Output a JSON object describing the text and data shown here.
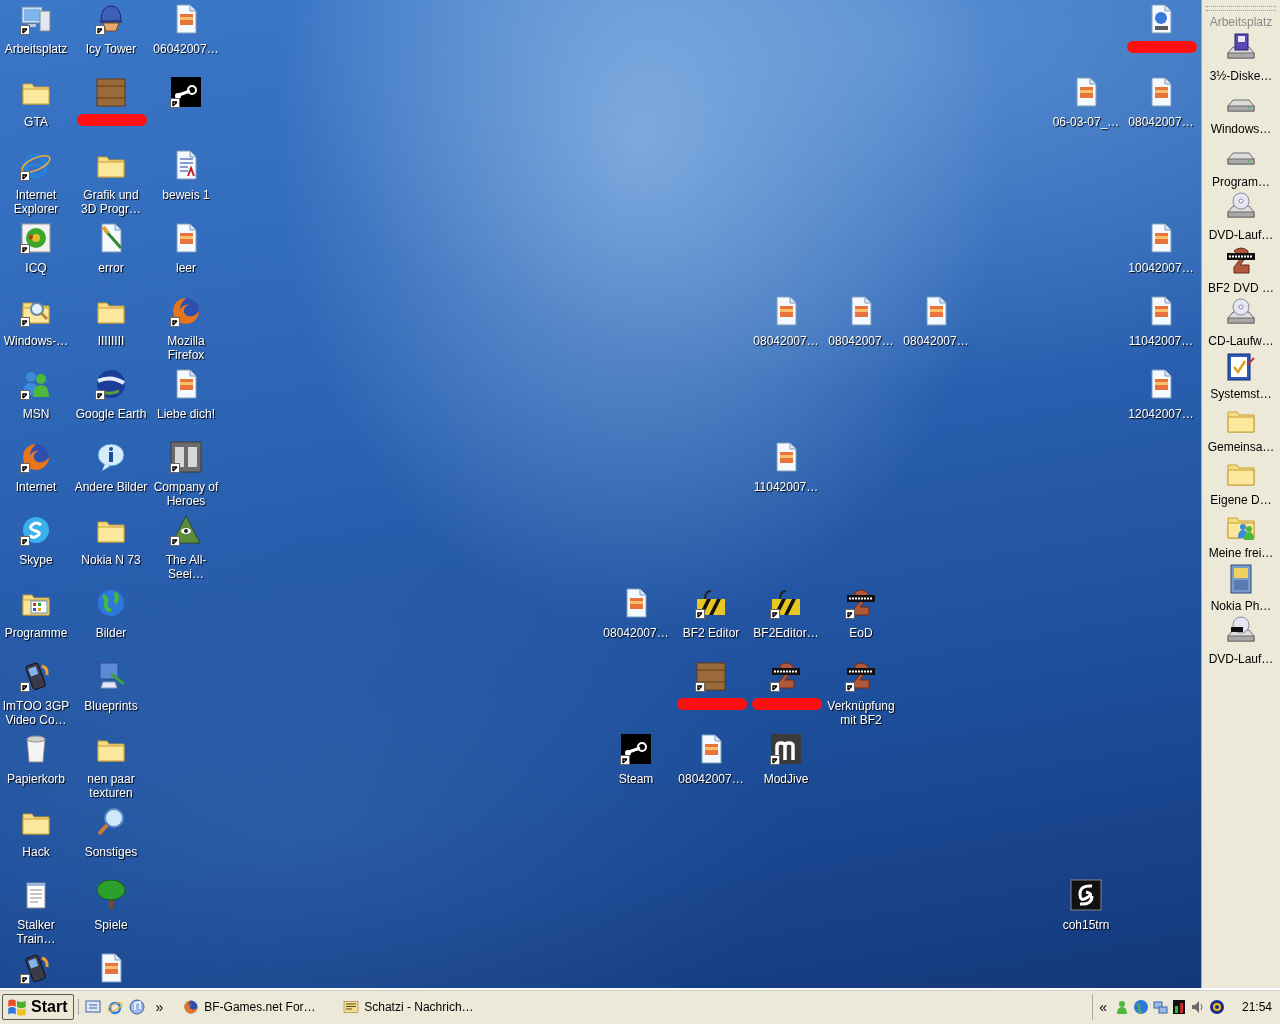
{
  "desktop": {
    "icons": [
      {
        "label": "Arbeitsplatz",
        "kind": "computer",
        "shortcut": true,
        "redacted": false
      },
      {
        "label": "Icy Tower",
        "kind": "hat",
        "shortcut": true,
        "redacted": false
      },
      {
        "label": "06042007…",
        "kind": "image-file",
        "shortcut": false,
        "redacted": false
      },
      {
        "kind": "video-file",
        "shortcut": false,
        "redacted": true
      },
      {
        "label": "GTA",
        "kind": "folder",
        "shortcut": false,
        "redacted": false
      },
      {
        "kind": "crate",
        "shortcut": false,
        "redacted": true
      },
      {
        "kind": "steam",
        "shortcut": true,
        "redacted": false
      },
      {
        "label": "06-03-07_…",
        "kind": "image-file",
        "shortcut": false,
        "redacted": false
      },
      {
        "label": "08042007…",
        "kind": "image-file",
        "shortcut": false,
        "redacted": false
      },
      {
        "label": "Internet Explorer",
        "kind": "ie",
        "shortcut": true,
        "redacted": false
      },
      {
        "label": "Grafik und 3D Progr…",
        "kind": "folder",
        "shortcut": false,
        "redacted": false
      },
      {
        "label": "beweis 1",
        "kind": "text-doc",
        "shortcut": false,
        "redacted": false
      },
      {
        "label": "ICQ",
        "kind": "flower",
        "shortcut": true,
        "redacted": false
      },
      {
        "label": "error",
        "kind": "paint-file",
        "shortcut": false,
        "redacted": false
      },
      {
        "label": "leer",
        "kind": "image-file",
        "shortcut": false,
        "redacted": false
      },
      {
        "label": "10042007…",
        "kind": "image-file",
        "shortcut": false,
        "redacted": false
      },
      {
        "label": "Windows-…",
        "kind": "search-folder",
        "shortcut": true,
        "redacted": false
      },
      {
        "label": "IIIIIIII",
        "kind": "folder",
        "shortcut": false,
        "redacted": false
      },
      {
        "label": "Mozilla Firefox",
        "kind": "firefox",
        "shortcut": true,
        "redacted": false
      },
      {
        "label": "08042007…",
        "kind": "image-file",
        "shortcut": false,
        "redacted": false
      },
      {
        "label": "08042007…",
        "kind": "image-file",
        "shortcut": false,
        "redacted": false
      },
      {
        "label": "08042007…",
        "kind": "image-file",
        "shortcut": false,
        "redacted": false
      },
      {
        "label": "11042007…",
        "kind": "image-file",
        "shortcut": false,
        "redacted": false
      },
      {
        "label": "MSN",
        "kind": "people",
        "shortcut": true,
        "redacted": false
      },
      {
        "label": "Google Earth",
        "kind": "earth",
        "shortcut": true,
        "redacted": false
      },
      {
        "label": "Liebe dich!",
        "kind": "image-file",
        "shortcut": false,
        "redacted": false
      },
      {
        "label": "12042007…",
        "kind": "image-file",
        "shortcut": false,
        "redacted": false
      },
      {
        "label": "Internet",
        "kind": "firefox",
        "shortcut": true,
        "redacted": false
      },
      {
        "label": "Andere Bilder",
        "kind": "info",
        "shortcut": false,
        "redacted": false
      },
      {
        "label": "Company of Heroes",
        "kind": "coh",
        "shortcut": true,
        "redacted": false
      },
      {
        "label": "11042007…",
        "kind": "image-file",
        "shortcut": false,
        "redacted": false
      },
      {
        "label": "Skype",
        "kind": "skype",
        "shortcut": true,
        "redacted": false
      },
      {
        "label": "Nokia N 73",
        "kind": "folder",
        "shortcut": false,
        "redacted": false
      },
      {
        "label": "The All-Seei…",
        "kind": "pyramid",
        "shortcut": true,
        "redacted": false
      },
      {
        "label": "Programme",
        "kind": "programs-folder",
        "shortcut": false,
        "redacted": false
      },
      {
        "label": "Bilder",
        "kind": "globe",
        "shortcut": false,
        "redacted": false
      },
      {
        "label": "08042007…",
        "kind": "image-file",
        "shortcut": false,
        "redacted": false
      },
      {
        "label": "BF2 Editor",
        "kind": "bf2edit",
        "shortcut": true,
        "redacted": false
      },
      {
        "label": "BF2Editor…",
        "kind": "bf2edit",
        "shortcut": true,
        "redacted": false
      },
      {
        "label": "EoD",
        "kind": "battlefield",
        "shortcut": true,
        "redacted": false
      },
      {
        "label": "ImTOO 3GP Video Co…",
        "kind": "phone",
        "shortcut": true,
        "redacted": false
      },
      {
        "label": "Blueprints",
        "kind": "blueprints",
        "shortcut": false,
        "redacted": false
      },
      {
        "kind": "crate",
        "shortcut": true,
        "redacted": true
      },
      {
        "kind": "battlefield",
        "shortcut": true,
        "redacted": true
      },
      {
        "label": "Verknüpfung mit BF2",
        "kind": "battlefield",
        "shortcut": true,
        "redacted": false
      },
      {
        "label": "Papierkorb",
        "kind": "bin",
        "shortcut": false,
        "redacted": false
      },
      {
        "label": "nen paar texturen",
        "kind": "folder",
        "shortcut": false,
        "redacted": false
      },
      {
        "label": "Steam",
        "kind": "steam",
        "shortcut": true,
        "redacted": false
      },
      {
        "label": "08042007…",
        "kind": "image-file",
        "shortcut": false,
        "redacted": false
      },
      {
        "label": "ModJive",
        "kind": "modjive",
        "shortcut": true,
        "redacted": false
      },
      {
        "label": "Hack",
        "kind": "folder",
        "shortcut": false,
        "redacted": false
      },
      {
        "label": "Sonstiges",
        "kind": "magnifier",
        "shortcut": false,
        "redacted": false
      },
      {
        "label": "Stalker Train…",
        "kind": "notepad",
        "shortcut": false,
        "redacted": false
      },
      {
        "label": "Spiele",
        "kind": "tree",
        "shortcut": false,
        "redacted": false
      },
      {
        "label": "coh15trn",
        "kind": "coh15",
        "shortcut": false,
        "redacted": false
      },
      {
        "kind": "phone",
        "shortcut": true,
        "redacted": false
      },
      {
        "kind": "image-file",
        "shortcut": false,
        "redacted": false
      }
    ]
  },
  "deskbar": {
    "title": "Arbeitsplatz",
    "items": [
      {
        "label": "3½-Diske…",
        "kind": "floppy"
      },
      {
        "label": "Windows…",
        "kind": "hdd"
      },
      {
        "label": "Program…",
        "kind": "hdd"
      },
      {
        "label": "DVD-Lauf…",
        "kind": "cd-drive"
      },
      {
        "label": "BF2 DVD …",
        "kind": "battlefield"
      },
      {
        "label": "CD-Laufw…",
        "kind": "cd-drive"
      },
      {
        "label": "Systemst…",
        "kind": "checklist"
      },
      {
        "label": "Gemeinsa…",
        "kind": "folder"
      },
      {
        "label": "Eigene D…",
        "kind": "folder"
      },
      {
        "label": "Meine frei…",
        "kind": "people-folder"
      },
      {
        "label": "Nokia Ph…",
        "kind": "cabinet"
      },
      {
        "label": "DVD-Lauf…",
        "kind": "dvd-drive"
      }
    ]
  },
  "taskbar": {
    "start": "Start",
    "overflow": "»",
    "tasks": [
      {
        "label": "BF-Games.net For…",
        "kind": "firefox"
      },
      {
        "label": "Schatzi - Nachrich…",
        "kind": "message"
      }
    ],
    "tray": {
      "expand": "«",
      "clock": "21:54"
    }
  }
}
